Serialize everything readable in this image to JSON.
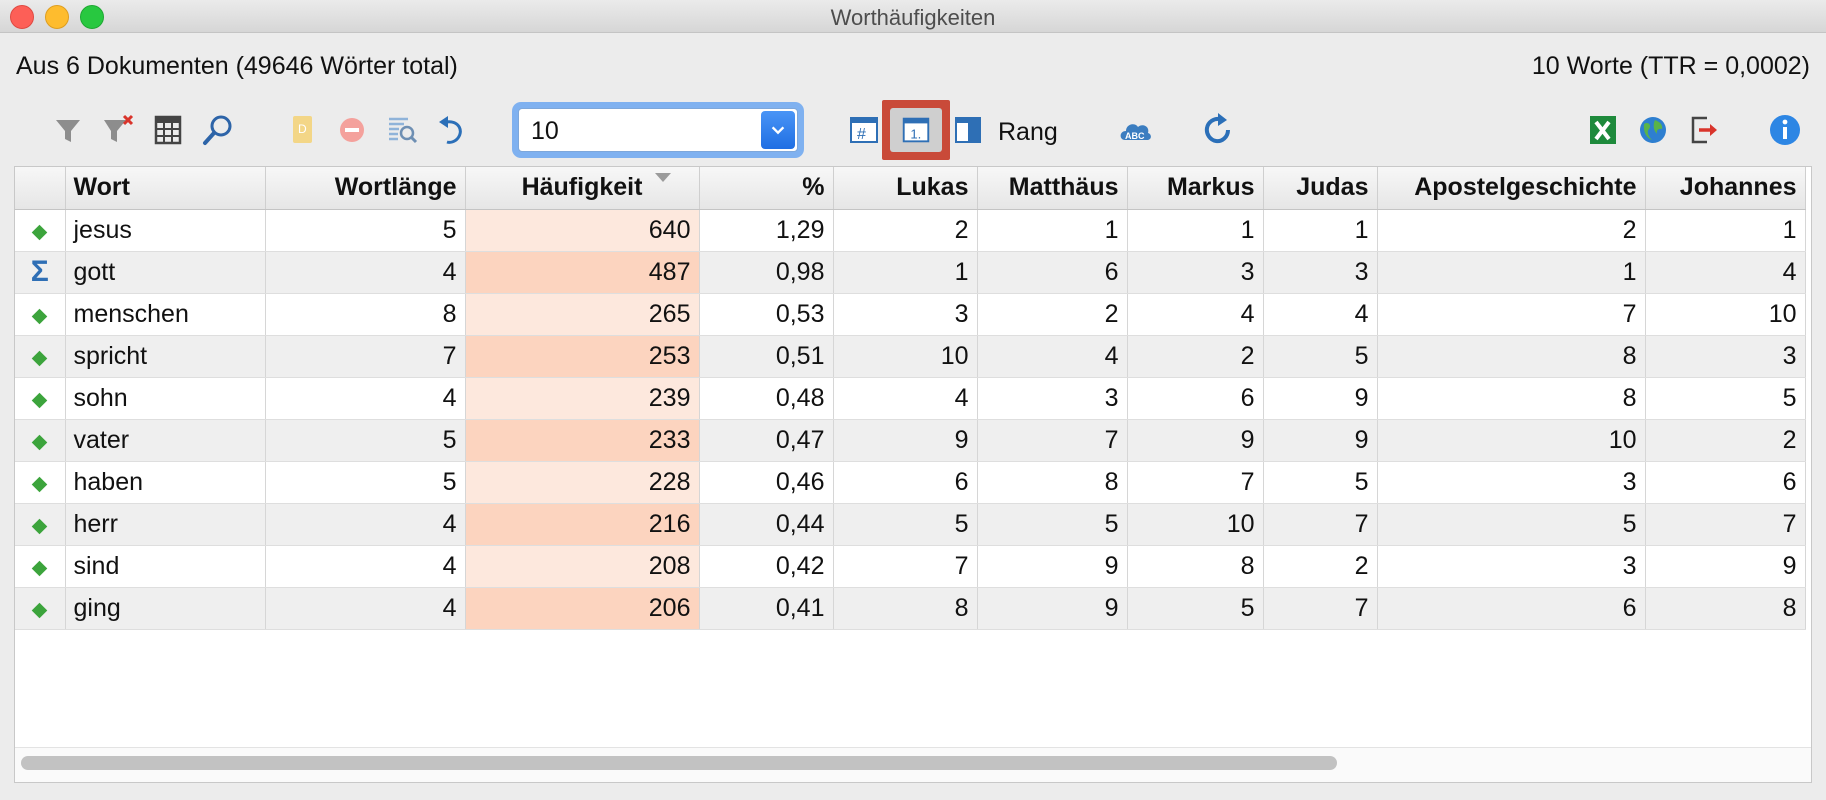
{
  "window": {
    "title": "Worthäufigkeiten"
  },
  "info": {
    "left": "Aus 6 Dokumenten (49646 Wörter total)",
    "right": "10 Worte (TTR = 0,0002)"
  },
  "toolbar": {
    "combo_value": "10",
    "rang_label": "Rang",
    "icons": [
      "filter-icon",
      "remove-filter-icon",
      "columns-icon",
      "search-icon",
      "document-icon",
      "delete-icon",
      "find-list-icon",
      "undo-icon",
      "hash-table-icon",
      "rank-icon",
      "book-icon",
      "cloud-abc-icon",
      "refresh-icon",
      "excel-icon",
      "globe-icon",
      "export-icon",
      "info-icon"
    ]
  },
  "colors": {
    "accent": "#2f7be8",
    "highlight": "#c94a39",
    "frequency_bg": "#fcd4bf",
    "diamond": "#3ca43c"
  },
  "table": {
    "headers": [
      "",
      "Wort",
      "Wortlänge",
      "Häufigkeit",
      "%",
      "Lukas",
      "Matthäus",
      "Markus",
      "Judas",
      "Apostelgeschichte",
      "Johannes"
    ],
    "rows": [
      {
        "icon": "diamond",
        "cells": [
          "jesus",
          "5",
          "640",
          "1,29",
          "2",
          "1",
          "1",
          "1",
          "2",
          "1"
        ]
      },
      {
        "icon": "sigma",
        "cells": [
          "gott",
          "4",
          "487",
          "0,98",
          "1",
          "6",
          "3",
          "3",
          "1",
          "4"
        ]
      },
      {
        "icon": "diamond",
        "cells": [
          "menschen",
          "8",
          "265",
          "0,53",
          "3",
          "2",
          "4",
          "4",
          "7",
          "10"
        ]
      },
      {
        "icon": "diamond",
        "cells": [
          "spricht",
          "7",
          "253",
          "0,51",
          "10",
          "4",
          "2",
          "5",
          "8",
          "3"
        ]
      },
      {
        "icon": "diamond",
        "cells": [
          "sohn",
          "4",
          "239",
          "0,48",
          "4",
          "3",
          "6",
          "9",
          "8",
          "5"
        ]
      },
      {
        "icon": "diamond",
        "cells": [
          "vater",
          "5",
          "233",
          "0,47",
          "9",
          "7",
          "9",
          "9",
          "10",
          "2"
        ]
      },
      {
        "icon": "diamond",
        "cells": [
          "haben",
          "5",
          "228",
          "0,46",
          "6",
          "8",
          "7",
          "5",
          "3",
          "6"
        ]
      },
      {
        "icon": "diamond",
        "cells": [
          "herr",
          "4",
          "216",
          "0,44",
          "5",
          "5",
          "10",
          "7",
          "5",
          "7"
        ]
      },
      {
        "icon": "diamond",
        "cells": [
          "sind",
          "4",
          "208",
          "0,42",
          "7",
          "9",
          "8",
          "2",
          "3",
          "9"
        ]
      },
      {
        "icon": "diamond",
        "cells": [
          "ging",
          "4",
          "206",
          "0,41",
          "8",
          "9",
          "5",
          "7",
          "6",
          "8"
        ]
      }
    ]
  }
}
